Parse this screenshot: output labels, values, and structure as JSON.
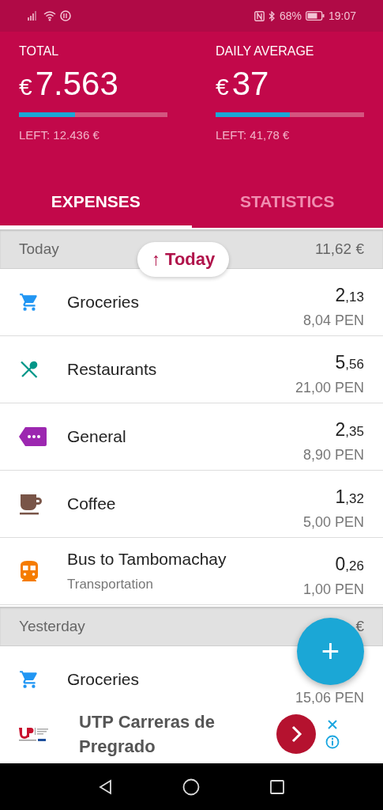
{
  "status_bar": {
    "battery": "68%",
    "time": "19:07"
  },
  "summary": [
    {
      "label": "TOTAL",
      "currency": "€",
      "value": "7.563",
      "level": 0.38,
      "left": "LEFT: 12.436 €"
    },
    {
      "label": "DAILY AVERAGE",
      "currency": "€",
      "value": "37",
      "level": 0.5,
      "left": "LEFT: 41,78 €"
    }
  ],
  "tabs": [
    {
      "label": "EXPENSES",
      "selected": true
    },
    {
      "label": "STATISTICS",
      "selected": false
    }
  ],
  "jump_chip": {
    "icon": "↑",
    "label": "Today"
  },
  "days": [
    {
      "title": "Today",
      "total": "11,62 €",
      "items": [
        {
          "kind": "cart",
          "color": "#2196f3",
          "name": "Groceries",
          "whole": "2",
          "fraction": ",13",
          "original": "8,04 PEN"
        },
        {
          "kind": "cutlery",
          "color": "#009688",
          "name": "Restaurants",
          "whole": "5",
          "fraction": ",56",
          "original": "21,00 PEN"
        },
        {
          "kind": "tag",
          "color": "#9c27b0",
          "name": "General",
          "whole": "2",
          "fraction": ",35",
          "original": "8,90 PEN"
        },
        {
          "kind": "cup",
          "color": "#795548",
          "name": "Coffee",
          "whole": "1",
          "fraction": ",32",
          "original": "5,00 PEN"
        },
        {
          "kind": "train",
          "color": "#f57c00",
          "name": "Bus to Tambomachay",
          "category": "Transportation",
          "whole": "0",
          "fraction": ",26",
          "original": "1,00 PEN"
        }
      ]
    },
    {
      "title": "Yesterday",
      "total": "€",
      "items": [
        {
          "kind": "cart",
          "color": "#2196f3",
          "name": "Groceries",
          "original": "15,06 PEN"
        }
      ]
    }
  ],
  "fab": {
    "label": "+"
  },
  "ad": {
    "title": "UTP Carreras de Pregrado"
  }
}
